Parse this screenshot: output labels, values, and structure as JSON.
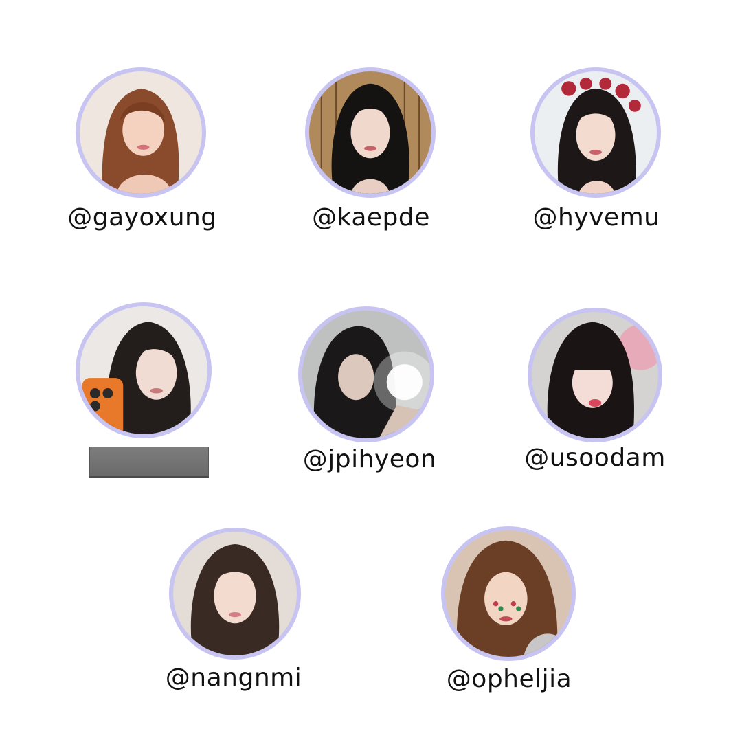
{
  "ring_color": "#c8c4f2",
  "profiles": [
    {
      "handle": "@gayoxung",
      "photo_icon": "portrait-woman-brown-hair-icon"
    },
    {
      "handle": "@kaepde",
      "photo_icon": "portrait-woman-black-hair-icon"
    },
    {
      "handle": "@hyvemu",
      "photo_icon": "portrait-woman-flower-crown-icon"
    },
    {
      "handle": "",
      "photo_icon": "portrait-woman-phone-selfie-icon"
    },
    {
      "handle": "@jpihyeon",
      "photo_icon": "portrait-woman-mirror-flash-icon"
    },
    {
      "handle": "@usoodam",
      "photo_icon": "portrait-woman-bangs-icon"
    },
    {
      "handle": "@nangnmi",
      "photo_icon": "portrait-woman-long-hair-icon"
    },
    {
      "handle": "@opheljia",
      "photo_icon": "portrait-woman-face-gems-icon"
    }
  ]
}
